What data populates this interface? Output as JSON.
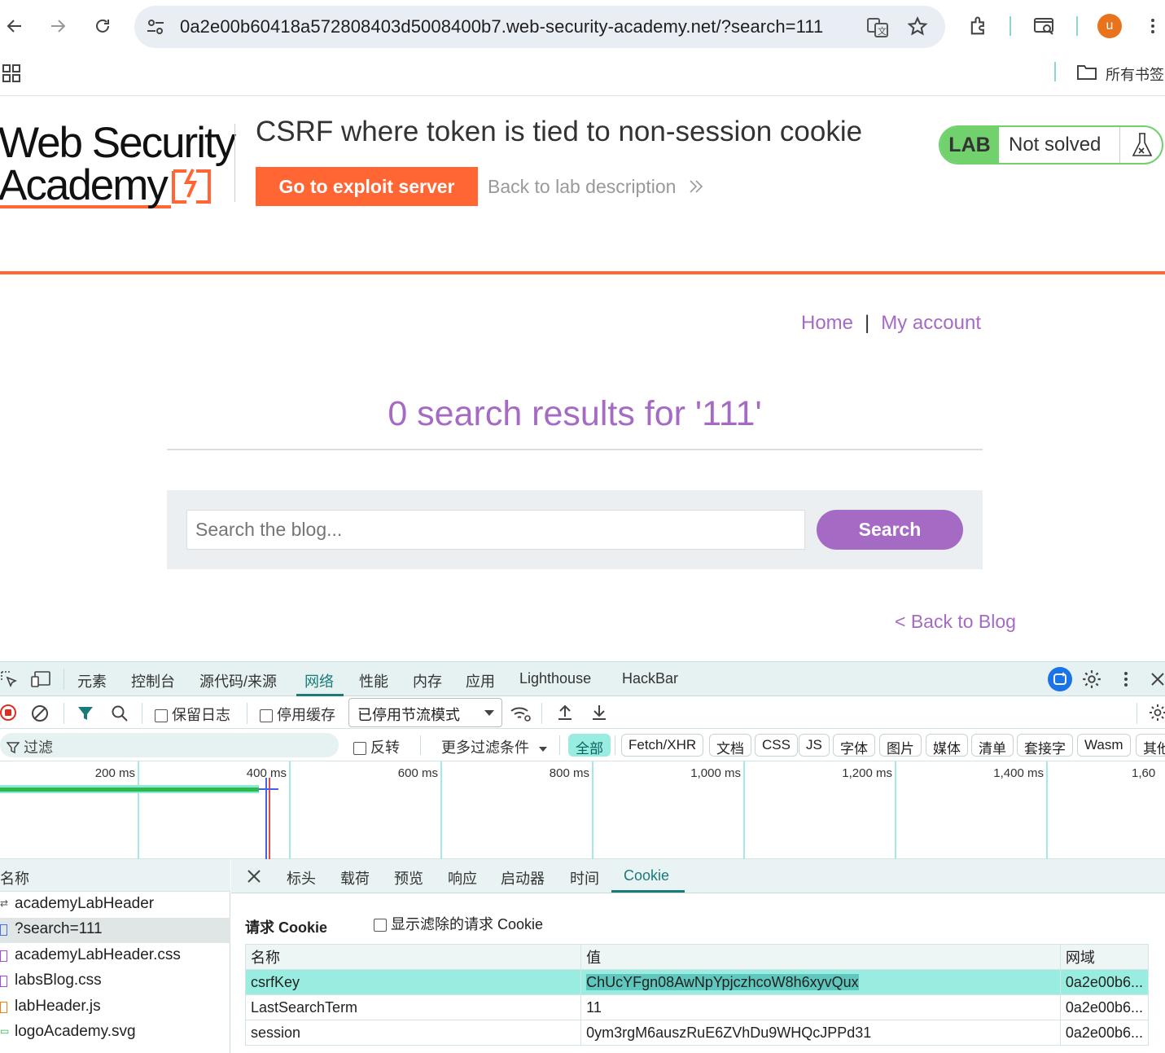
{
  "browser": {
    "url": "0a2e00b60418a572808403d5008400b7.web-security-academy.net/?search=111",
    "profile_initial": "u",
    "bookmarks_label": "所有书签"
  },
  "lab": {
    "logo_line1": "Web Security",
    "logo_line2": "Academy",
    "title": "CSRF where token is tied to non-session cookie",
    "exploit_button": "Go to exploit server",
    "back_to_description": "Back to lab description",
    "badge": "LAB",
    "status": "Not solved",
    "accent_color": "#ff6633",
    "status_color": "#70d16d"
  },
  "page": {
    "nav_home": "Home",
    "nav_separator": "|",
    "nav_account": "My account",
    "results_title": "0 search results for '111'",
    "search_placeholder": "Search the blog...",
    "search_button": "Search",
    "back_to_blog": "< Back to Blog",
    "link_color": "#a56bc4"
  },
  "devtools": {
    "tabs": [
      "元素",
      "控制台",
      "源代码/来源",
      "网络",
      "性能",
      "内存",
      "应用",
      "Lighthouse",
      "HackBar"
    ],
    "active_tab": "网络",
    "toolbar": {
      "preserve_log": "保留日志",
      "disable_cache": "停用缓存",
      "throttle": "已停用节流模式"
    },
    "filter": {
      "placeholder": "过滤",
      "invert": "反转",
      "more_filters": "更多过滤条件",
      "chips": [
        "全部",
        "Fetch/XHR",
        "文档",
        "CSS",
        "JS",
        "字体",
        "图片",
        "媒体",
        "清单",
        "套接字",
        "Wasm",
        "其他"
      ],
      "active_chip": "全部"
    },
    "timeline_labels": [
      "200 ms",
      "400 ms",
      "600 ms",
      "800 ms",
      "1,000 ms",
      "1,200 ms",
      "1,400 ms",
      "1,60"
    ],
    "request_list": {
      "header": "名称",
      "items": [
        "academyLabHeader",
        "?search=111",
        "academyLabHeader.css",
        "labsBlog.css",
        "labHeader.js",
        "logoAcademy.svg"
      ],
      "selected": "?search=111"
    },
    "detail_tabs": [
      "标头",
      "载荷",
      "预览",
      "响应",
      "启动器",
      "时间",
      "Cookie"
    ],
    "active_detail_tab": "Cookie",
    "cookies": {
      "section_title": "请求 Cookie",
      "show_filtered": "显示滤除的请求 Cookie",
      "columns": [
        "名称",
        "值",
        "网域"
      ],
      "rows": [
        {
          "name": "csrfKey",
          "value": "ChUcYFgn08AwNpYpjczhcoW8h6xyvQux",
          "domain": "0a2e00b6..."
        },
        {
          "name": "LastSearchTerm",
          "value": "11",
          "domain": "0a2e00b6..."
        },
        {
          "name": "session",
          "value": "0ym3rgM6auszRuE6ZVhDu9WHQcJPPd31",
          "domain": "0a2e00b6..."
        }
      ]
    }
  }
}
